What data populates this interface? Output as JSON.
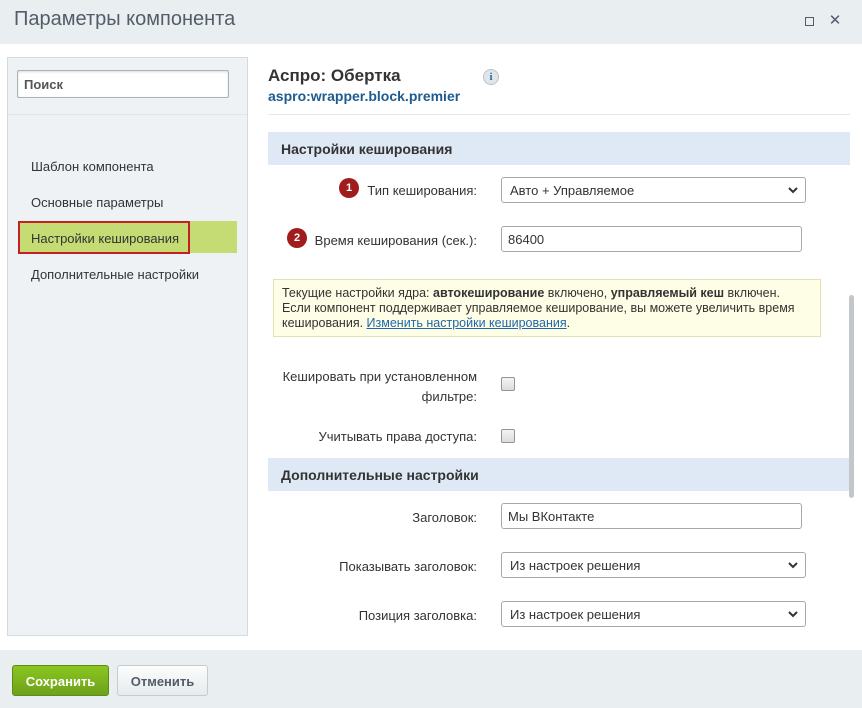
{
  "window": {
    "title": "Параметры компонента"
  },
  "sidebar": {
    "search_placeholder": "Поиск",
    "items": [
      {
        "label": "Шаблон компонента"
      },
      {
        "label": "Основные параметры"
      },
      {
        "label": "Настройки кеширования",
        "active": true
      },
      {
        "label": "Дополнительные настройки"
      }
    ]
  },
  "component": {
    "title": "Аспро: Обертка",
    "code": "aspro:wrapper.block.premier",
    "info_icon": "i"
  },
  "caching": {
    "section_title": "Настройки кеширования",
    "cache_type_label": "Тип кеширования:",
    "cache_type_badge": "1",
    "cache_type_value": "Авто + Управляемое",
    "cache_time_label": "Время кеширования (сек.):",
    "cache_time_badge": "2",
    "cache_time_value": "86400",
    "notice_prefix": "Текущие настройки ядра: ",
    "notice_bold1": "автокеширование",
    "notice_mid1": " включено, ",
    "notice_bold2": "управляемый кеш",
    "notice_mid2": " включен. Если компонент поддерживает управляемое кеширование, вы можете увеличить время кеширования. ",
    "notice_link": "Изменить настройки кеширования",
    "notice_suffix": ".",
    "cache_filter_label_line1": "Кешировать при установленном",
    "cache_filter_label_line2": "фильтре:",
    "cache_filter_checked": false,
    "access_rights_label": "Учитывать права доступа:",
    "access_rights_checked": false
  },
  "additional": {
    "section_title": "Дополнительные настройки",
    "heading_label": "Заголовок:",
    "heading_value": "Мы ВКонтакте",
    "show_heading_label": "Показывать заголовок:",
    "show_heading_value": "Из настроек решения",
    "heading_position_label": "Позиция заголовка:",
    "heading_position_value": "Из настроек решения"
  },
  "footer": {
    "save_label": "Сохранить",
    "cancel_label": "Отменить"
  },
  "colors": {
    "active_nav": "#c5dc74",
    "highlight_border": "#c41f25",
    "section_bg": "#dfe9f5",
    "badge": "#a11c1d",
    "save_button": "#7ab31e"
  }
}
